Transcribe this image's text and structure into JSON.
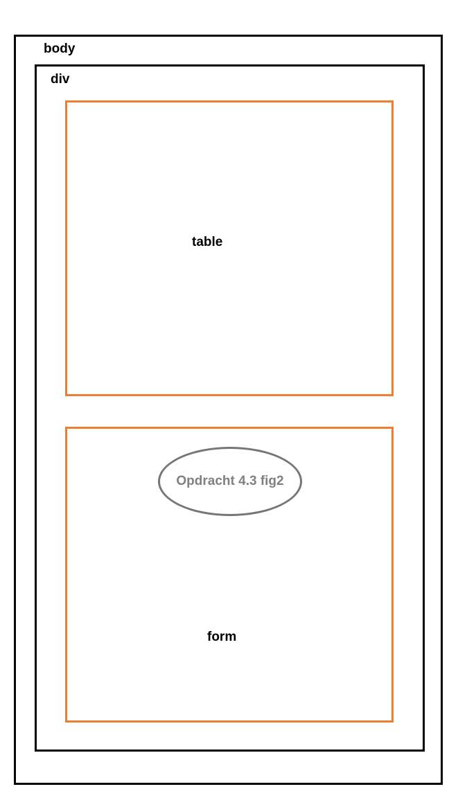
{
  "labels": {
    "body": "body",
    "div": "div",
    "table": "table",
    "form": "form"
  },
  "annotation": {
    "text": "Opdracht 4.3 fig2"
  },
  "colors": {
    "outer_border": "#000000",
    "element_border": "#ED7D31",
    "annotation_border": "#767676",
    "annotation_text": "#808080"
  }
}
